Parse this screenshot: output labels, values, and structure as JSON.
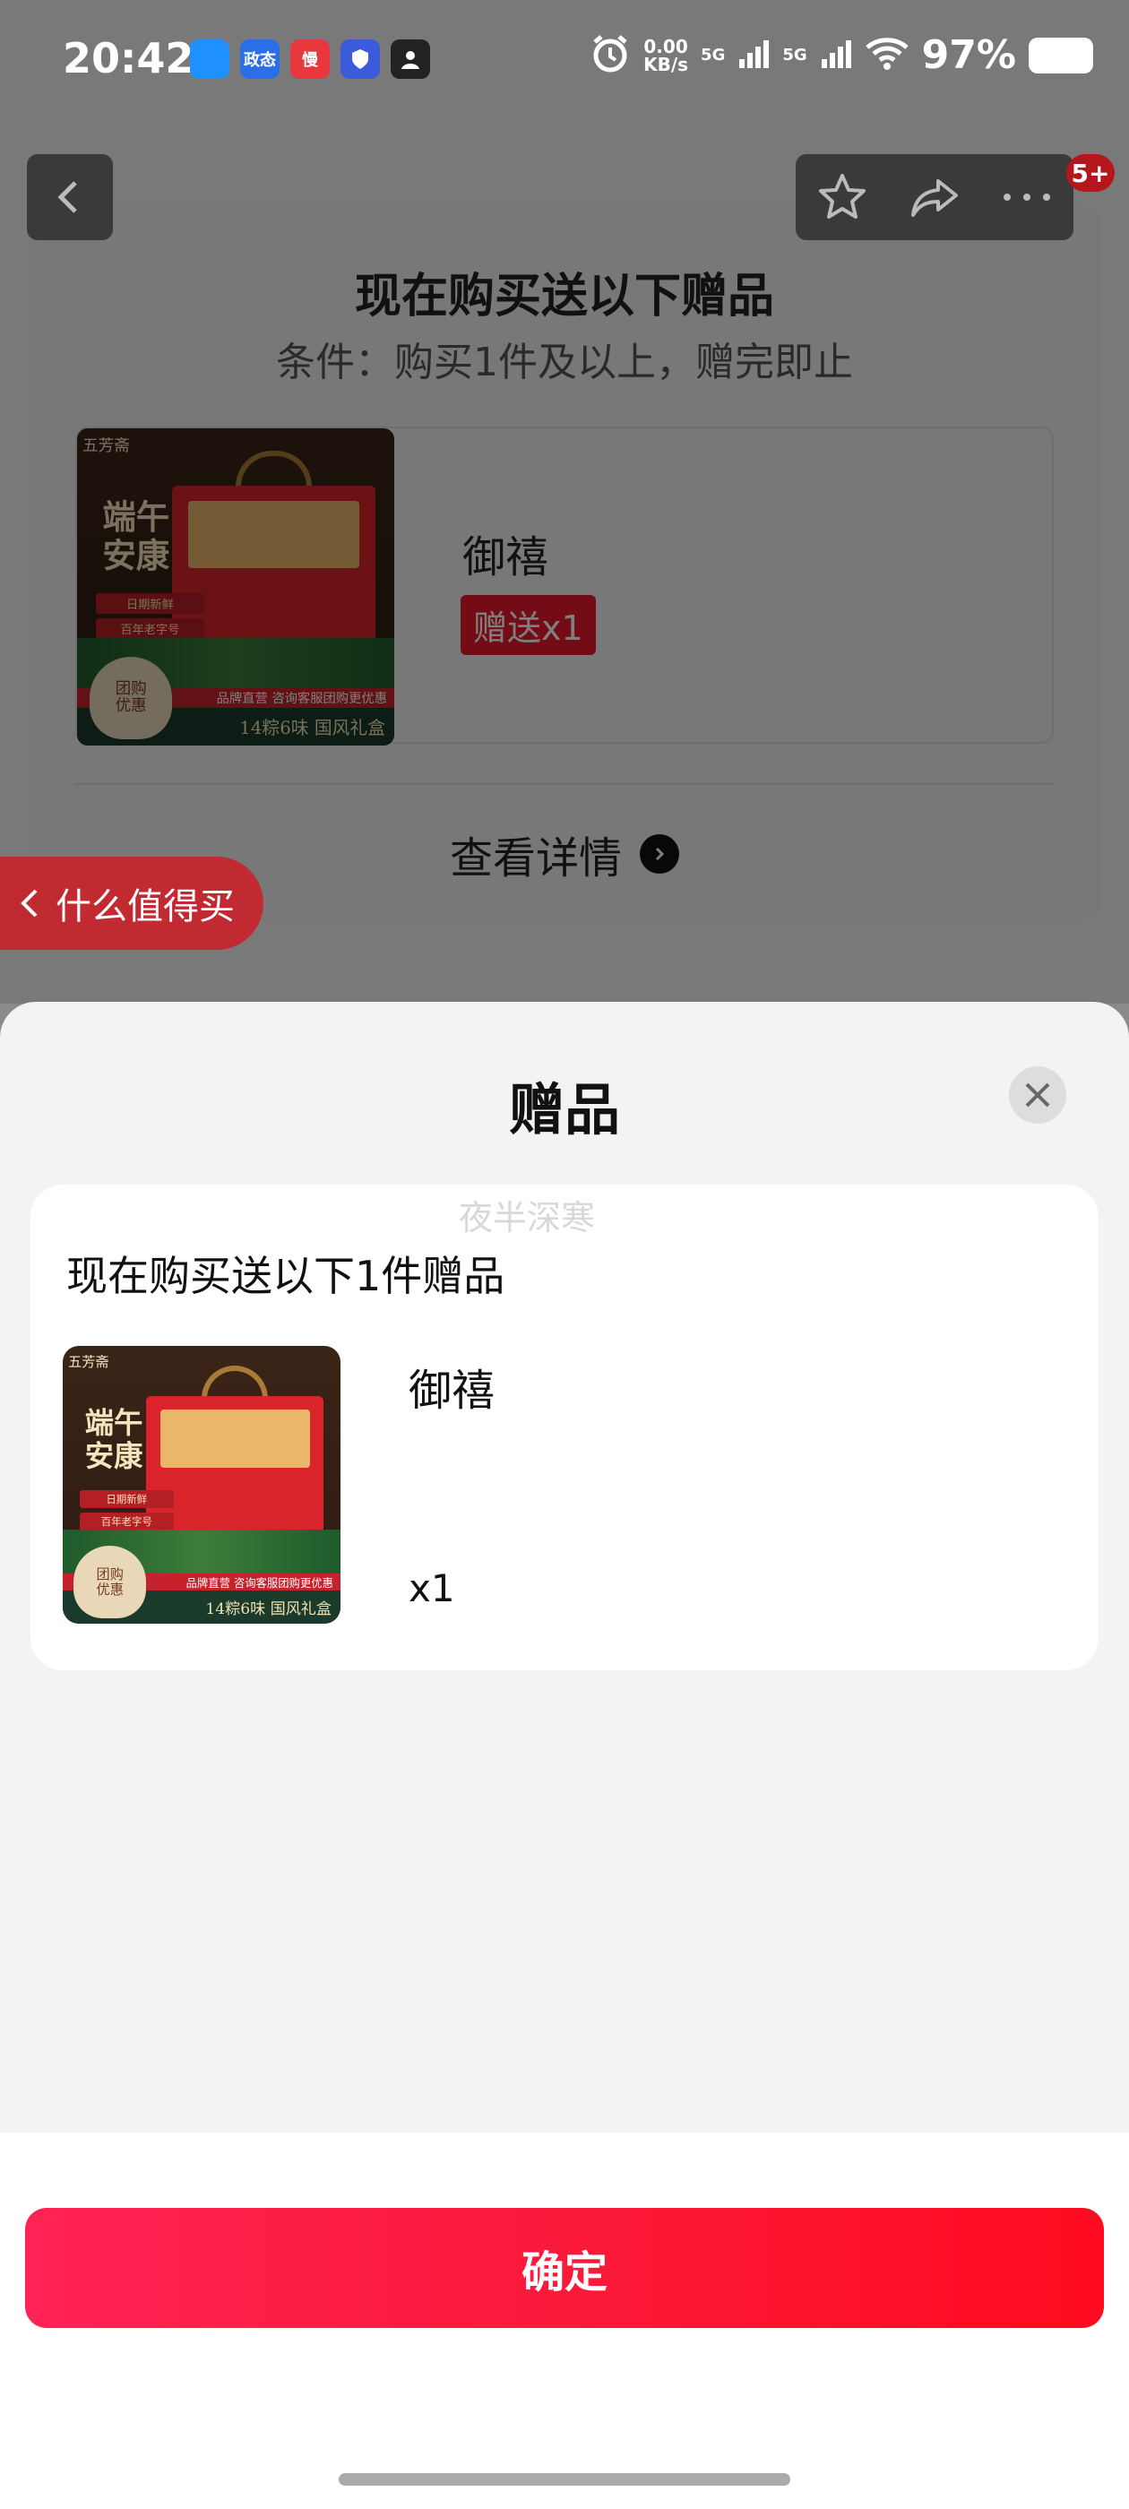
{
  "status_bar": {
    "time": "20:42",
    "notification_icons": [
      {
        "name": "app-blue-icon",
        "color": "#1e90ff",
        "text": ""
      },
      {
        "name": "app-news-icon",
        "color": "#2a6fe8",
        "text": "政态"
      },
      {
        "name": "app-red-icon",
        "color": "#e8383d",
        "text": "慢"
      },
      {
        "name": "app-shield-icon",
        "color": "#3b5bdb",
        "text": ""
      },
      {
        "name": "app-dark-icon",
        "color": "#222222",
        "text": ""
      }
    ],
    "net_speed": "0.00",
    "net_unit": "KB/s",
    "signal_1": "5G",
    "signal_2": "5G",
    "battery": "97%"
  },
  "background_page": {
    "badge": "5+",
    "gift_card": {
      "title": "现在购买送以下赠品",
      "condition": "条件：购买1件及以上，赠完即止",
      "item_name": "御禧",
      "item_tag": "赠送x1",
      "detail_link": "查看详情"
    },
    "float_pill": "什么值得买"
  },
  "product_image": {
    "brand": "五芳斋",
    "headline_1": "端午",
    "headline_2": "安康",
    "tag_1": "日期新鲜",
    "tag_2": "百年老字号",
    "seal_1": "团购",
    "seal_2": "优惠",
    "red_strip": "品牌直营 咨询客服团购更优惠",
    "bottom_strip": "14粽6味 国风礼盒"
  },
  "sheet": {
    "title": "赠品",
    "watermark": "夜半深寒",
    "list_heading": "现在购买送以下1件赠品",
    "item_name": "御禧",
    "item_qty": "x1",
    "confirm": "确定"
  },
  "colors": {
    "accent": "#ff1a3c",
    "tag_red": "#e8192c"
  }
}
